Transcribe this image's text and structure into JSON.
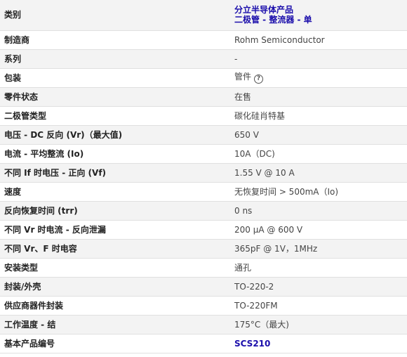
{
  "rows": [
    {
      "label": "类别",
      "value_line1": "分立半导体产品",
      "value_line2": "二极管 - 整流器 - 单"
    },
    {
      "label": "制造商",
      "value": "Rohm Semiconductor"
    },
    {
      "label": "系列",
      "value": "-"
    },
    {
      "label": "包装",
      "value": "管件"
    },
    {
      "label": "零件状态",
      "value": "在售"
    },
    {
      "label": "二极管类型",
      "value": "碳化硅肖特基"
    },
    {
      "label": "电压 - DC 反向 (Vr)（最大值)",
      "value": "650 V"
    },
    {
      "label": "电流 - 平均整流 (Io)",
      "value": "10A（DC)"
    },
    {
      "label": "不同 If 时电压 - 正向 (Vf)",
      "value": "1.55 V @ 10 A"
    },
    {
      "label": "速度",
      "value": "无恢复时间 > 500mA（Io)"
    },
    {
      "label": "反向恢复时间 (trr)",
      "value": "0 ns"
    },
    {
      "label": "不同 Vr 时电流 - 反向泄漏",
      "value": "200 µA @ 600 V"
    },
    {
      "label": "不同 Vr、F 时电容",
      "value": "365pF @ 1V，1MHz"
    },
    {
      "label": "安装类型",
      "value": "通孔"
    },
    {
      "label": "封装/外壳",
      "value": "TO-220-2"
    },
    {
      "label": "供应商器件封装",
      "value": "TO-220FM"
    },
    {
      "label": "工作温度 - 结",
      "value": "175°C（最大)"
    },
    {
      "label": "基本产品编号",
      "value": "SCS210"
    }
  ],
  "help_icon": {
    "name": "question-circle-icon",
    "glyph": "?"
  },
  "colors": {
    "link": "#1a0dab",
    "row_alt": "#f3f3f3",
    "border": "#e0e0e0"
  }
}
